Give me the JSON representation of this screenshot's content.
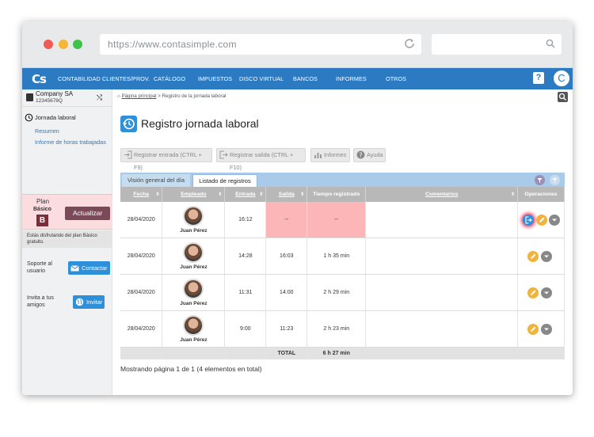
{
  "browser": {
    "url": "https://www.contasimple.com"
  },
  "nav": {
    "logo": "Cs",
    "items": [
      "CONTABILIDAD",
      "CLIENTES/PROV.",
      "CATÁLOGO",
      "IMPUESTOS",
      "DISCO VIRTUAL",
      "BANCOS",
      "INFORMES",
      "OTROS"
    ],
    "help": "?",
    "user_initial": "C"
  },
  "sidebar": {
    "company_name": "Company SA",
    "company_nif": "12345678Q",
    "section_title": "Jornada laboral",
    "links": [
      "Resumen",
      "Informe de horas trabajadas"
    ],
    "plan_label": "Plan",
    "plan_name": "Básico",
    "plan_badge": "B",
    "upgrade_label": "Actualizar",
    "plan_note": "Estás disfrutando del plan Básico gratuito.",
    "support_label": "Soporte al usuario",
    "contact_label": "Contactar",
    "invite_text": "Invita a tus amigos",
    "invite_label": "Invitar"
  },
  "breadcrumb": {
    "home": "Página principal",
    "current": " > Registro de la jornada laboral"
  },
  "page": {
    "title": "Registro jornada laboral"
  },
  "toolbar": {
    "entry_label": "Registrar entrada (CTRL + F9)",
    "exit_label": "Registrar salida (CTRL + F10)",
    "reports_label": "Informes",
    "help_label": "Ayuda"
  },
  "tabs": [
    "Visión general del día",
    "Listado de registros"
  ],
  "table": {
    "headers": [
      "Fecha",
      "Empleado",
      "Entrada",
      "Salida",
      "Tiempo registrado",
      "Comentarios",
      "Operaciones"
    ],
    "rows": [
      {
        "fecha": "28/04/2020",
        "empleado": "Juan Pérez",
        "entrada": "16:12",
        "salida": "--",
        "tiempo": "--",
        "comentarios": ""
      },
      {
        "fecha": "28/04/2020",
        "empleado": "Juan Pérez",
        "entrada": "14:28",
        "salida": "16:03",
        "tiempo": "1 h 35 min",
        "comentarios": ""
      },
      {
        "fecha": "28/04/2020",
        "empleado": "Juan Pérez",
        "entrada": "11:31",
        "salida": "14:00",
        "tiempo": "2 h 29 min",
        "comentarios": ""
      },
      {
        "fecha": "28/04/2020",
        "empleado": "Juan Pérez",
        "entrada": "9:00",
        "salida": "11:23",
        "tiempo": "2 h 23 min",
        "comentarios": ""
      }
    ],
    "total_label": "TOTAL",
    "total_value": "6 h 27 min"
  },
  "footer": {
    "pagination": "Mostrando página 1 de 1 (4 elementos en total)"
  },
  "colors": {
    "brand_blue": "#2c7ac2",
    "open_record_red": "#fcb6b8",
    "edit_orange": "#f3b23c"
  }
}
